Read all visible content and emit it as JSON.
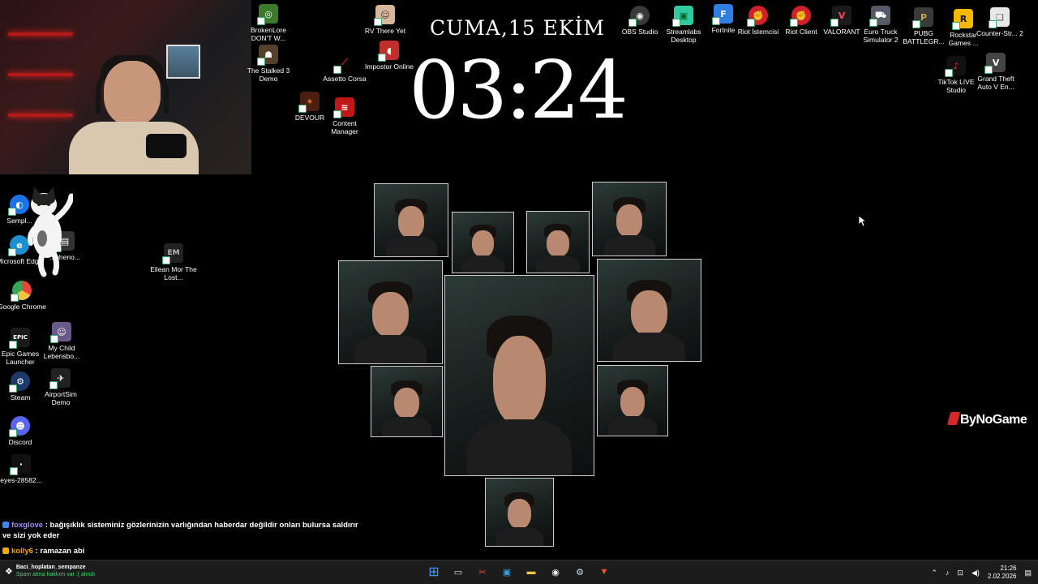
{
  "clock": {
    "date": "CUMA,15 EKİM",
    "time": "03:24"
  },
  "desktop_icons": [
    {
      "label": "BrokenLore DON'T W...",
      "color": "#3b7a2a",
      "glyph": "◎"
    },
    {
      "label": "The Stalked 3 Demo",
      "color": "#55402a",
      "glyph": "☗"
    },
    {
      "label": "RV There Yet",
      "color": "#d8b69a",
      "glyph": "☺"
    },
    {
      "label": "Impostor Online",
      "color": "#c0302a",
      "glyph": "◖"
    },
    {
      "label": "Assetto Corsa",
      "color": "#b5202a",
      "glyph": "⟋"
    },
    {
      "label": "DEVOUR",
      "color": "#4a1e10",
      "glyph": "✶"
    },
    {
      "label": "Content Manager",
      "color": "#c01818",
      "glyph": "≋"
    },
    {
      "label": "OBS Studio",
      "color": "#3a3a3a",
      "glyph": "◉"
    },
    {
      "label": "Streamlabs Desktop",
      "color": "#30c9a0",
      "glyph": "▣"
    },
    {
      "label": "Fortnite",
      "color": "#2f7fe0",
      "glyph": "F"
    },
    {
      "label": "Riot İstemcisi",
      "color": "#d0202a",
      "glyph": "✊"
    },
    {
      "label": "Riot Client",
      "color": "#d0202a",
      "glyph": "✊"
    },
    {
      "label": "VALORANT",
      "color": "#ff4655",
      "glyph": "V"
    },
    {
      "label": "Euro Truck Simulator 2",
      "color": "#555a66",
      "glyph": "⛟"
    },
    {
      "label": "PUBG BATTLEGR...",
      "color": "#c9a44a",
      "glyph": "P"
    },
    {
      "label": "Rockstar Games ...",
      "color": "#f5b800",
      "glyph": "R"
    },
    {
      "label": "Counter-Str... 2",
      "color": "#e8e8e8",
      "glyph": "❏"
    },
    {
      "label": "TikTok LIVE Studio",
      "color": "#111111",
      "glyph": "♪"
    },
    {
      "label": "Grand Theft Auto V En...",
      "color": "#444444",
      "glyph": "V"
    },
    {
      "label": "Sempl...",
      "color": "#1a73e8",
      "glyph": "◐"
    },
    {
      "label": "Microsoft Edge",
      "color": "#1c8fd0",
      "glyph": "e"
    },
    {
      "label": "...pheno...",
      "color": "#333333",
      "glyph": "▤"
    },
    {
      "label": "Eilean Mor The Lost...",
      "color": "#222222",
      "glyph": "EM"
    },
    {
      "label": "Google Chrome",
      "color": "#e8453c",
      "glyph": "◉"
    },
    {
      "label": "Epic Games Launcher",
      "color": "#1a1a1a",
      "glyph": "EPIC"
    },
    {
      "label": "My Child Lebensbo...",
      "color": "#6a5a8a",
      "glyph": "☺"
    },
    {
      "label": "Steam",
      "color": "#1b3a6a",
      "glyph": "⚙"
    },
    {
      "label": "AirportSim Demo",
      "color": "#222222",
      "glyph": "✈"
    },
    {
      "label": "Discord",
      "color": "#5865f2",
      "glyph": "☻"
    },
    {
      "label": "eyes-28582...",
      "color": "#111111",
      "glyph": "·"
    }
  ],
  "brand": {
    "text": "ByNoGame"
  },
  "chat": [
    {
      "user": "foxglove",
      "sep": " : ",
      "text": "bağışıklık sisteminiz gözlerinizin varlığından haberdar değildir onları bulursa saldırır ve sizi yok eder",
      "user_color": "#a78bfa"
    },
    {
      "user": "kolly6",
      "sep": " : ",
      "text": "ramazan abi",
      "user_color": "#f0a500"
    }
  ],
  "taskbar": {
    "notification_title": "Baci_hoplatan_sempanze",
    "notification_sub": "Spam atma hakkım var :( alındı",
    "apps": [
      {
        "name": "start",
        "glyph": "⊞",
        "color": "#3b9bff"
      },
      {
        "name": "task-view",
        "glyph": "▭",
        "color": "#dddddd"
      },
      {
        "name": "snipping",
        "glyph": "✂",
        "color": "#e8453c"
      },
      {
        "name": "photos",
        "glyph": "▣",
        "color": "#3aa0e0"
      },
      {
        "name": "explorer",
        "glyph": "▬",
        "color": "#f5c242"
      },
      {
        "name": "obs",
        "glyph": "◉",
        "color": "#eeeeee"
      },
      {
        "name": "steam",
        "glyph": "⚙",
        "color": "#cfe0f5"
      },
      {
        "name": "brave",
        "glyph": "▼",
        "color": "#fb542b"
      }
    ],
    "time": "21:26",
    "date": "2.02.2026"
  }
}
